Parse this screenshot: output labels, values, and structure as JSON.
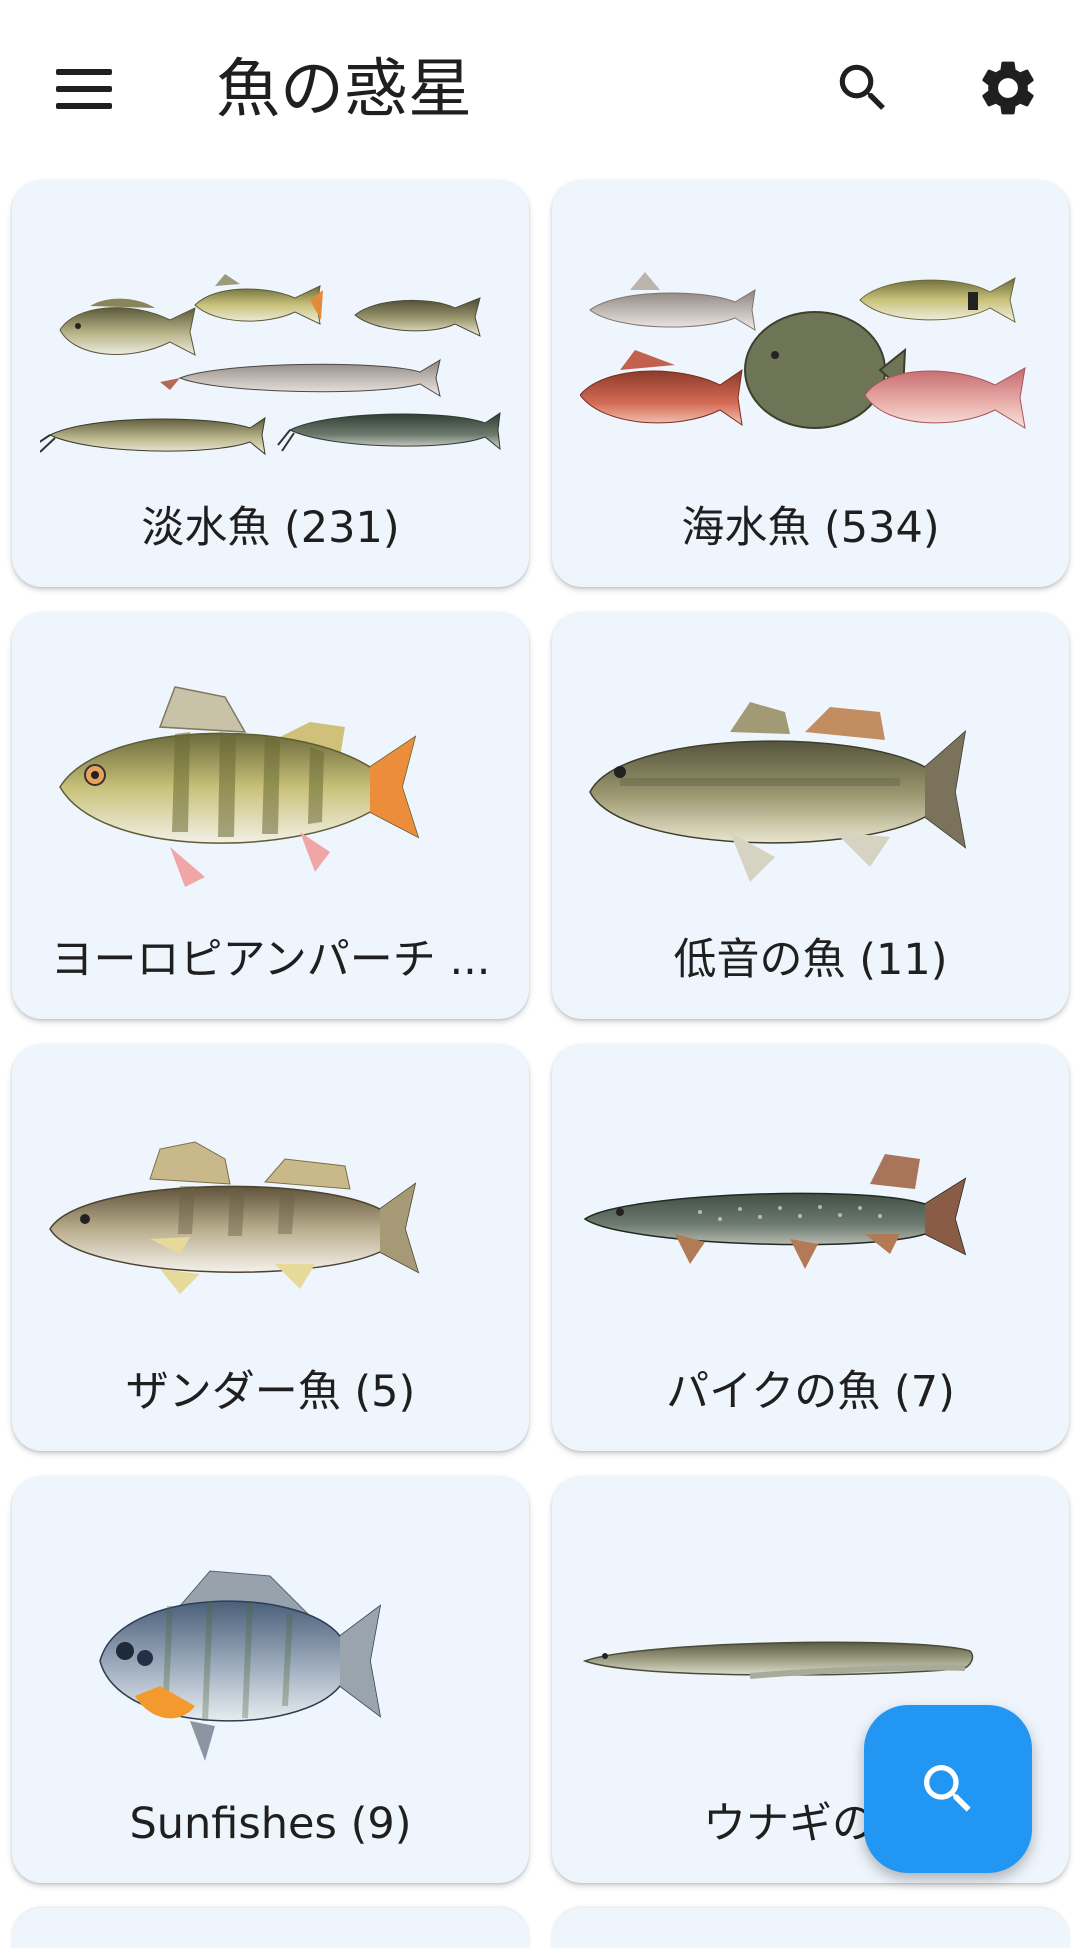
{
  "app": {
    "title": "魚の惑星"
  },
  "toolbar": {
    "menu_icon": "menu-icon",
    "search_icon": "search-icon",
    "settings_icon": "gear-icon"
  },
  "categories": [
    {
      "label": "淡水魚 (231)",
      "image": "freshwater-fish-group"
    },
    {
      "label": "海水魚 (534)",
      "image": "saltwater-fish-group"
    },
    {
      "label": "ヨーロピアンパーチ ...",
      "image": "european-perch"
    },
    {
      "label": "低音の魚 (11)",
      "image": "bass-fish"
    },
    {
      "label": "ザンダー魚 (5)",
      "image": "zander-fish"
    },
    {
      "label": "パイクの魚 (7)",
      "image": "pike-fish"
    },
    {
      "label": "Sunfishes (9)",
      "image": "sunfish"
    },
    {
      "label": "ウナギの魚",
      "image": "eel"
    }
  ],
  "fab": {
    "icon": "search-icon",
    "color": "#2196f3"
  },
  "colors": {
    "card_bg": "#eff5fc",
    "accent": "#2196f3"
  }
}
